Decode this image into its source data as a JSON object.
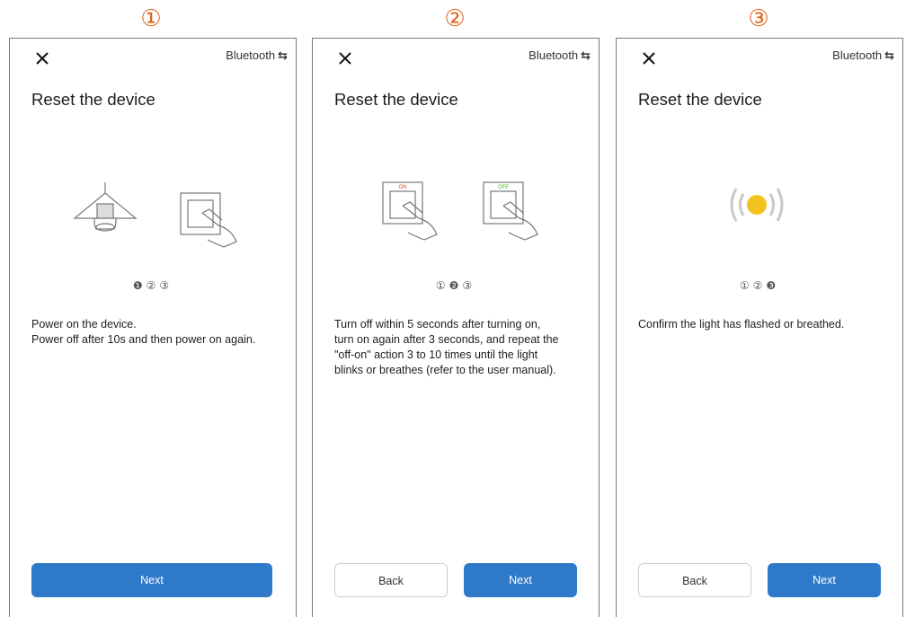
{
  "step_markers": [
    "①",
    "②",
    "③"
  ],
  "screens": [
    {
      "close_icon": "close-icon",
      "bluetooth_label": "Bluetooth",
      "bluetooth_icon": "⇆",
      "title": "Reset the device",
      "dots": [
        "❶",
        "②",
        "③"
      ],
      "description_lines": [
        "Power on the device.",
        "Power off after 10s and then power on again."
      ],
      "next_label": "Next"
    },
    {
      "close_icon": "close-icon",
      "bluetooth_label": "Bluetooth",
      "bluetooth_icon": "⇆",
      "title": "Reset the device",
      "switch_on_label": "ON",
      "switch_off_label": "OFF",
      "dots": [
        "①",
        "❷",
        "③"
      ],
      "description_lines": [
        "Turn off within 5 seconds after turning on,",
        "turn on again after 3 seconds, and repeat the",
        "\"off-on\" action 3 to 10 times until the light",
        "blinks or breathes (refer to the user manual)."
      ],
      "back_label": "Back",
      "next_label": "Next"
    },
    {
      "close_icon": "close-icon",
      "bluetooth_label": "Bluetooth",
      "bluetooth_icon": "⇆",
      "title": "Reset the device",
      "dots": [
        "①",
        "②",
        "❸"
      ],
      "description_lines": [
        "Confirm the light has flashed or breathed."
      ],
      "back_label": "Back",
      "next_label": "Next"
    }
  ],
  "colors": {
    "accent": "#2f79c9",
    "step_marker": "#e0661f",
    "light": "#f4c21f",
    "switch_on": "#e04a2a",
    "switch_off": "#5aa83a"
  }
}
